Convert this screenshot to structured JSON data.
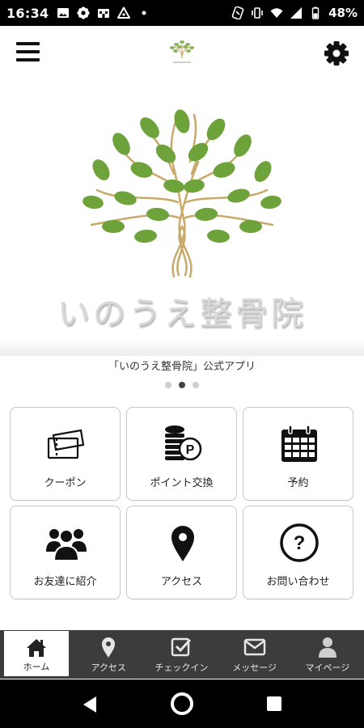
{
  "status_bar": {
    "time": "16:34",
    "battery": "48%",
    "icons": [
      "image-icon",
      "flower-icon",
      "store-icon",
      "triangle-alert-icon",
      "dot-icon",
      "nfc-icon",
      "vibrate-icon",
      "wifi-icon",
      "signal-icon",
      "battery-icon"
    ]
  },
  "header": {
    "menu_icon": "hamburger-menu-icon",
    "logo_icon": "tree-logo-icon",
    "settings_icon": "gear-icon"
  },
  "hero": {
    "brand": "いのうえ整骨院",
    "colors": {
      "leaf": "#6ea23a",
      "trunk": "#c8a96a"
    }
  },
  "subtitle": "「いのうえ整骨院」公式アプリ",
  "carousel": {
    "count": 3,
    "active_index": 1
  },
  "tiles": [
    {
      "label": "クーポン",
      "icon": "ticket-icon"
    },
    {
      "label": "ポイント交換",
      "icon": "coins-icon"
    },
    {
      "label": "予約",
      "icon": "calendar-icon"
    },
    {
      "label": "お友達に紹介",
      "icon": "friends-icon"
    },
    {
      "label": "アクセス",
      "icon": "map-pin-icon"
    },
    {
      "label": "お問い合わせ",
      "icon": "question-icon"
    }
  ],
  "bottom_nav": [
    {
      "label": "ホーム",
      "icon": "home-icon",
      "active": true
    },
    {
      "label": "アクセス",
      "icon": "map-pin-icon",
      "active": false
    },
    {
      "label": "チェックイン",
      "icon": "checkin-icon",
      "active": false
    },
    {
      "label": "メッセージ",
      "icon": "mail-icon",
      "active": false
    },
    {
      "label": "マイページ",
      "icon": "user-icon",
      "active": false
    }
  ],
  "system_nav": {
    "back_icon": "back-icon",
    "home_icon": "home-circle-icon",
    "recent_icon": "recent-apps-icon"
  }
}
